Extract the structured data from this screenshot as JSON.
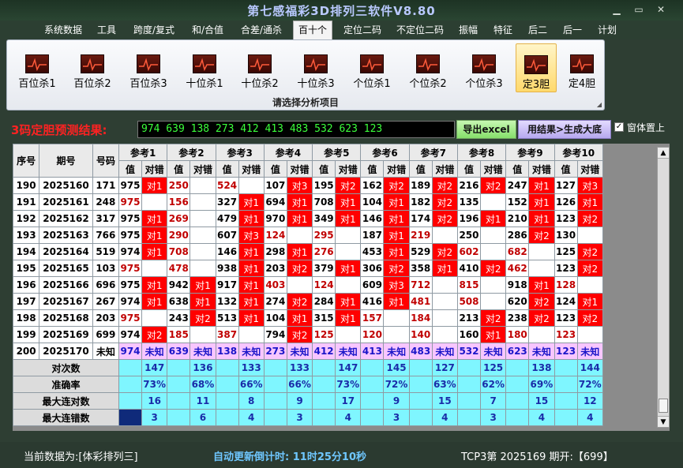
{
  "window": {
    "title": "第七感福彩3D排列三软件V8.80",
    "minimize": "▁",
    "restore": "▭",
    "close": "✕"
  },
  "menu": [
    "系统数据",
    "工具",
    "跨度/复式",
    "和/合值",
    "合差/通杀",
    "百十个",
    "定位二码",
    "不定位二码",
    "振幅",
    "特征",
    "后二",
    "后一",
    "计划"
  ],
  "menu_active": "百十个",
  "ribbon": {
    "items": [
      "百位杀1",
      "百位杀2",
      "百位杀3",
      "十位杀1",
      "十位杀2",
      "十位杀3",
      "个位杀1",
      "个位杀2",
      "个位杀3",
      "定3胆",
      "定4胆"
    ],
    "selected": "定3胆",
    "caption": "请选择分析项目",
    "icon": "chart-icon"
  },
  "result": {
    "label": "3码定胆预测结果:",
    "value": "974 639 138 273 412 413 483 532 623 123",
    "export_btn": "导出excel",
    "gen_btn": "用结果>生成大底",
    "topmost_label": "窗体置上",
    "topmost_checked": "✓"
  },
  "table": {
    "col_seq": "序号",
    "col_issue": "期号",
    "col_number": "号码",
    "ref_groups": [
      "参考1",
      "参考2",
      "参考3",
      "参考4",
      "参考5",
      "参考6",
      "参考7",
      "参考8",
      "参考9",
      "参考10"
    ],
    "sub_value": "值",
    "sub_result": "对错",
    "rows": [
      {
        "seq": "190",
        "issue": "2025160",
        "number": "171",
        "cells": [
          [
            "975",
            "对1"
          ],
          [
            "250",
            ""
          ],
          [
            "524",
            ""
          ],
          [
            "107",
            "对3"
          ],
          [
            "195",
            "对2"
          ],
          [
            "162",
            "对2"
          ],
          [
            "189",
            "对2"
          ],
          [
            "216",
            "对2"
          ],
          [
            "247",
            "对1"
          ],
          [
            "127",
            "对3"
          ]
        ]
      },
      {
        "seq": "191",
        "issue": "2025161",
        "number": "248",
        "cells": [
          [
            "975",
            ""
          ],
          [
            "156",
            ""
          ],
          [
            "327",
            "对1"
          ],
          [
            "694",
            "对1"
          ],
          [
            "708",
            "对1"
          ],
          [
            "104",
            "对1"
          ],
          [
            "182",
            "对2"
          ],
          [
            "135",
            ""
          ],
          [
            "152",
            "对1"
          ],
          [
            "126",
            "对1"
          ]
        ]
      },
      {
        "seq": "192",
        "issue": "2025162",
        "number": "317",
        "cells": [
          [
            "975",
            "对1"
          ],
          [
            "269",
            ""
          ],
          [
            "479",
            "对1"
          ],
          [
            "970",
            "对1"
          ],
          [
            "349",
            "对1"
          ],
          [
            "146",
            "对1"
          ],
          [
            "174",
            "对2"
          ],
          [
            "196",
            "对1"
          ],
          [
            "210",
            "对1"
          ],
          [
            "123",
            "对2"
          ]
        ]
      },
      {
        "seq": "193",
        "issue": "2025163",
        "number": "766",
        "cells": [
          [
            "975",
            "对1"
          ],
          [
            "290",
            ""
          ],
          [
            "607",
            "对3"
          ],
          [
            "124",
            ""
          ],
          [
            "295",
            ""
          ],
          [
            "187",
            "对1"
          ],
          [
            "219",
            ""
          ],
          [
            "250",
            ""
          ],
          [
            "286",
            "对2"
          ],
          [
            "130",
            ""
          ]
        ]
      },
      {
        "seq": "194",
        "issue": "2025164",
        "number": "519",
        "cells": [
          [
            "974",
            "对1"
          ],
          [
            "708",
            ""
          ],
          [
            "146",
            "对1"
          ],
          [
            "298",
            "对1"
          ],
          [
            "276",
            ""
          ],
          [
            "453",
            "对1"
          ],
          [
            "529",
            "对2"
          ],
          [
            "602",
            ""
          ],
          [
            "682",
            ""
          ],
          [
            "125",
            "对2"
          ]
        ]
      },
      {
        "seq": "195",
        "issue": "2025165",
        "number": "103",
        "cells": [
          [
            "975",
            ""
          ],
          [
            "478",
            ""
          ],
          [
            "938",
            "对1"
          ],
          [
            "203",
            "对2"
          ],
          [
            "379",
            "对1"
          ],
          [
            "306",
            "对2"
          ],
          [
            "358",
            "对1"
          ],
          [
            "410",
            "对2"
          ],
          [
            "462",
            ""
          ],
          [
            "123",
            "对2"
          ]
        ]
      },
      {
        "seq": "196",
        "issue": "2025166",
        "number": "696",
        "cells": [
          [
            "975",
            "对1"
          ],
          [
            "942",
            "对1"
          ],
          [
            "917",
            "对1"
          ],
          [
            "403",
            ""
          ],
          [
            "124",
            ""
          ],
          [
            "609",
            "对3"
          ],
          [
            "712",
            ""
          ],
          [
            "815",
            ""
          ],
          [
            "918",
            "对1"
          ],
          [
            "128",
            ""
          ]
        ]
      },
      {
        "seq": "197",
        "issue": "2025167",
        "number": "267",
        "cells": [
          [
            "974",
            "对1"
          ],
          [
            "638",
            "对1"
          ],
          [
            "132",
            "对1"
          ],
          [
            "274",
            "对2"
          ],
          [
            "284",
            "对1"
          ],
          [
            "416",
            "对1"
          ],
          [
            "481",
            ""
          ],
          [
            "508",
            ""
          ],
          [
            "620",
            "对2"
          ],
          [
            "124",
            "对1"
          ]
        ]
      },
      {
        "seq": "198",
        "issue": "2025168",
        "number": "203",
        "cells": [
          [
            "975",
            ""
          ],
          [
            "243",
            "对2"
          ],
          [
            "513",
            "对1"
          ],
          [
            "104",
            "对1"
          ],
          [
            "315",
            "对1"
          ],
          [
            "157",
            ""
          ],
          [
            "184",
            ""
          ],
          [
            "213",
            "对2"
          ],
          [
            "238",
            "对2"
          ],
          [
            "123",
            "对2"
          ]
        ]
      },
      {
        "seq": "199",
        "issue": "2025169",
        "number": "699",
        "cells": [
          [
            "974",
            "对2"
          ],
          [
            "185",
            ""
          ],
          [
            "387",
            ""
          ],
          [
            "794",
            "对2"
          ],
          [
            "125",
            ""
          ],
          [
            "120",
            ""
          ],
          [
            "140",
            ""
          ],
          [
            "160",
            "对1"
          ],
          [
            "180",
            ""
          ],
          [
            "123",
            ""
          ]
        ]
      }
    ],
    "red_value_cells": {
      "190": [
        1,
        2
      ],
      "191": [
        0,
        1
      ],
      "192": [
        1
      ],
      "193": [
        1,
        3,
        4,
        6
      ],
      "194": [
        1,
        4,
        7,
        8
      ],
      "195": [
        0,
        1,
        8
      ],
      "196": [
        3,
        4,
        6,
        7,
        9
      ],
      "197": [
        6,
        7
      ],
      "198": [
        0,
        5,
        6
      ],
      "199": [
        1,
        2,
        4,
        5,
        6,
        8,
        9
      ]
    },
    "future_row": {
      "seq": "200",
      "issue": "2025170",
      "number": "未知",
      "values": [
        "974",
        "639",
        "138",
        "273",
        "412",
        "413",
        "483",
        "532",
        "623",
        "123"
      ],
      "unknown": "未知"
    },
    "stats": [
      {
        "label": "对次数",
        "values": [
          "147",
          "136",
          "133",
          "133",
          "147",
          "145",
          "127",
          "125",
          "138",
          "144"
        ]
      },
      {
        "label": "准确率",
        "values": [
          "73%",
          "68%",
          "66%",
          "66%",
          "73%",
          "72%",
          "63%",
          "62%",
          "69%",
          "72%"
        ]
      },
      {
        "label": "最大连对数",
        "values": [
          "16",
          "11",
          "8",
          "9",
          "17",
          "9",
          "15",
          "7",
          "15",
          "12"
        ]
      },
      {
        "label": "最大连错数",
        "values": [
          "3",
          "6",
          "4",
          "3",
          "4",
          "3",
          "4",
          "3",
          "4",
          "4"
        ]
      }
    ]
  },
  "status": {
    "source": "当前数据为:[体彩排列三]",
    "countdown": "自动更新倒计时: 11时25分10秒",
    "issue_info": "TCP3第 2025169 期开:【699】"
  },
  "colors": {
    "hit_red": "#ff0000",
    "stat_cyan": "#7ff6ff",
    "future_pink": "#f8c6ff",
    "result_green": "#3bff3b",
    "title_blue": "#b9c9ff"
  }
}
